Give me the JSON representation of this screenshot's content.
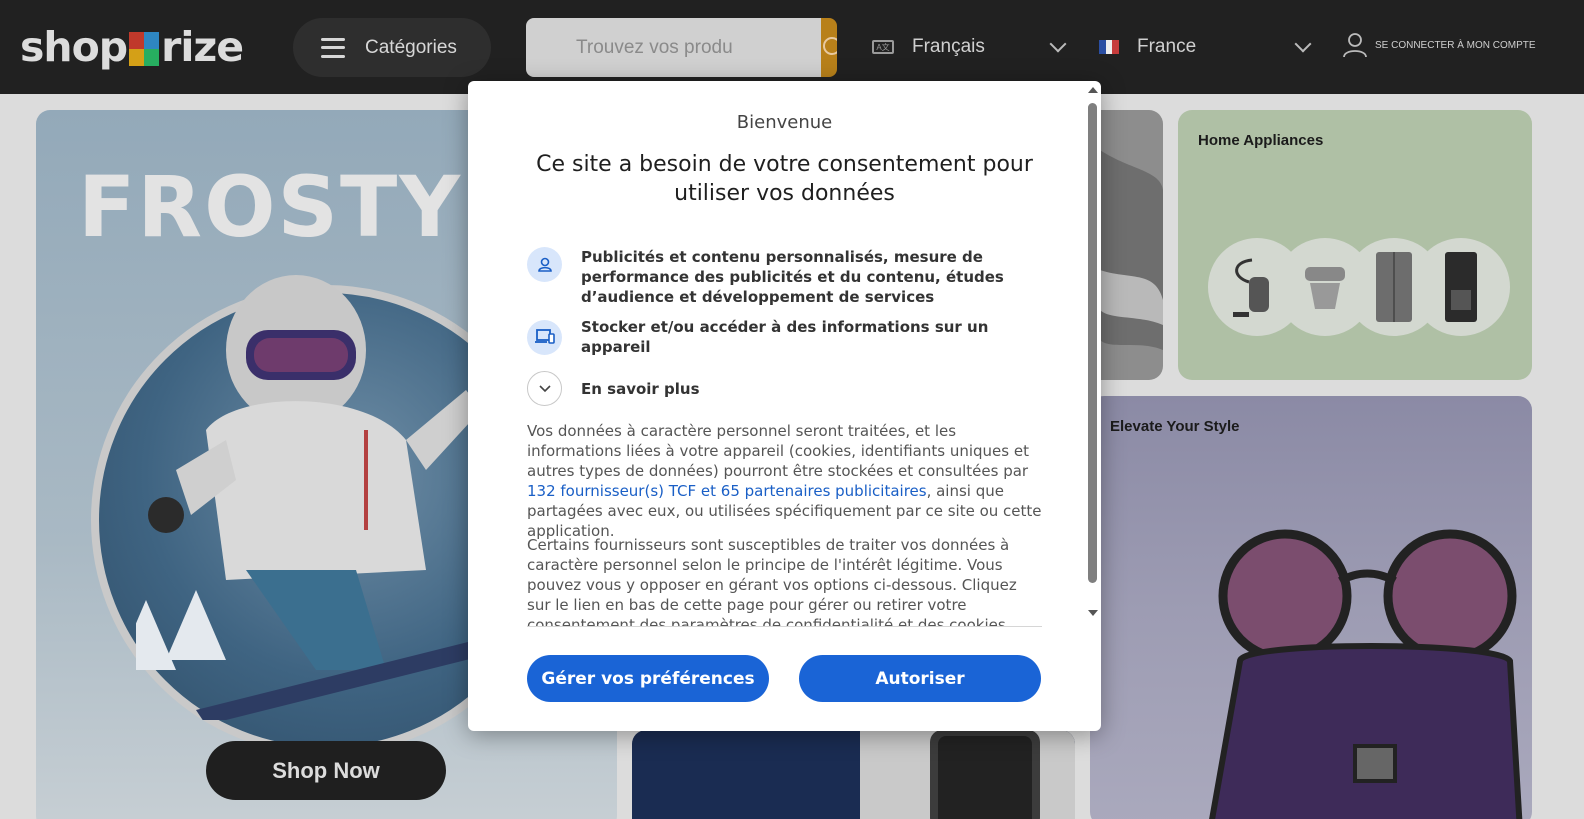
{
  "header": {
    "logo_left": "shop",
    "logo_right": "rize",
    "categories_label": "Catégories",
    "search_placeholder": "Trouvez vos produ",
    "language": "Français",
    "country": "France",
    "account_label": "SE CONNECTER À MON COMPTE"
  },
  "promo": {
    "frost_title": "FROSTY FU",
    "shop_now": "Shop Now",
    "home_appliances": "Home Appliances",
    "elevate_style": "Elevate Your Style"
  },
  "consent": {
    "welcome": "Bienvenue",
    "headline": "Ce site a besoin de votre consentement pour utiliser vos données",
    "purposes": [
      {
        "icon": "person-icon",
        "text": "Publicités et contenu personnalisés, mesure de performance des publicités et du contenu, études d’audience et développement de services"
      },
      {
        "icon": "devices-icon",
        "text": "Stocker et/ou accéder à des informations sur un appareil"
      }
    ],
    "learn_more": "En savoir plus",
    "para1_before": "Vos données à caractère personnel seront traitées, et les informations liées à votre appareil (cookies, identifiants uniques et autres types de données) pourront être stockées et consultées par ",
    "para1_link": "132 fournisseur(s) TCF et 65 partenaires publicitaires",
    "para1_after": ", ainsi que partagées avec eux, ou utilisées spécifiquement par ce site ou cette application.",
    "para2": "Certains fournisseurs sont susceptibles de traiter vos données à caractère personnel selon le principe de l'intérêt légitime. Vous pouvez vous y opposer en gérant vos options ci-dessous. Cliquez sur le lien en bas de cette page pour gérer ou retirer votre consentement des paramètres de confidentialité et des cookies.",
    "manage_button": "Gérer vos préférences",
    "allow_button": "Autoriser"
  },
  "colors": {
    "header_bg": "#212121",
    "primary_blue": "#1a64d6",
    "search_button": "#b8801a",
    "link": "#1a5fc6"
  }
}
